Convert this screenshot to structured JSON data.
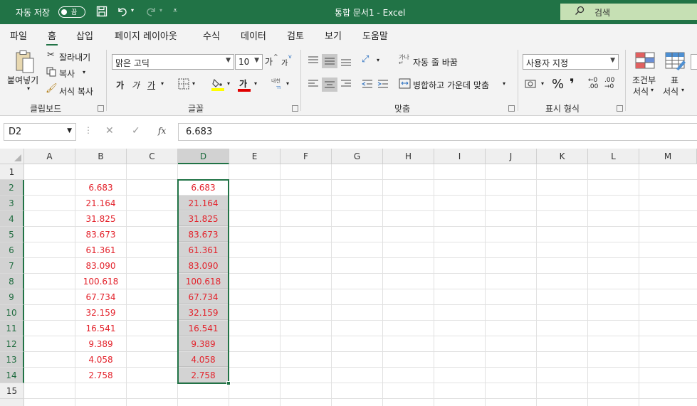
{
  "titlebar": {
    "autosave_label": "자동 저장",
    "autosave_state": "끔",
    "doc_title": "통합 문서1  -  Excel",
    "search_placeholder": "검색"
  },
  "menu": [
    "파일",
    "홈",
    "삽입",
    "페이지 레이아웃",
    "수식",
    "데이터",
    "검토",
    "보기",
    "도움말"
  ],
  "menu_active": "홈",
  "ribbon": {
    "clipboard": {
      "paste": "붙여넣기",
      "cut": "잘라내기",
      "copy": "복사",
      "format_painter": "서식 복사",
      "group_label": "클립보드"
    },
    "font": {
      "font_name": "맑은 고딕",
      "font_size": "10",
      "grow": "가",
      "shrink": "가",
      "bold": "가",
      "italic": "가",
      "underline": "가",
      "font_color_glyph": "가",
      "phonetic": "내천",
      "group_label": "글꼴",
      "font_color": "#e00000",
      "highlight_color": "#ffff00"
    },
    "alignment": {
      "wrap_text": "자동 줄 바꿈",
      "merge_center": "병합하고 가운데 맞춤",
      "group_label": "맞춤"
    },
    "number": {
      "format": "사용자 지정",
      "percent": "%",
      "comma": "❜",
      "group_label": "표시 형식"
    },
    "styles": {
      "conditional_line1": "조건부",
      "conditional_line2": "서식",
      "table_line1": "표",
      "table_line2": "서식"
    }
  },
  "formula_bar": {
    "name_box": "D2",
    "cancel": "✕",
    "enter": "✓",
    "fx": "fx",
    "value": "6.683"
  },
  "sheet": {
    "columns": [
      "A",
      "B",
      "C",
      "D",
      "E",
      "F",
      "G",
      "H",
      "I",
      "J",
      "K",
      "L",
      "M"
    ],
    "rows": [
      "1",
      "2",
      "3",
      "4",
      "5",
      "6",
      "7",
      "8",
      "9",
      "10",
      "11",
      "12",
      "13",
      "14",
      "15"
    ],
    "selected_column": "D",
    "col_b": [
      "6.683",
      "21.164",
      "31.825",
      "83.673",
      "61.361",
      "83.090",
      "100.618",
      "67.734",
      "32.159",
      "16.541",
      "9.389",
      "4.058",
      "2.758"
    ],
    "col_d": [
      "6.683",
      "21.164",
      "31.825",
      "83.673",
      "61.361",
      "83.090",
      "100.618",
      "67.734",
      "32.159",
      "16.541",
      "9.389",
      "4.058",
      "2.758"
    ],
    "text_color": "#e3222b",
    "accent_color": "#217346"
  }
}
